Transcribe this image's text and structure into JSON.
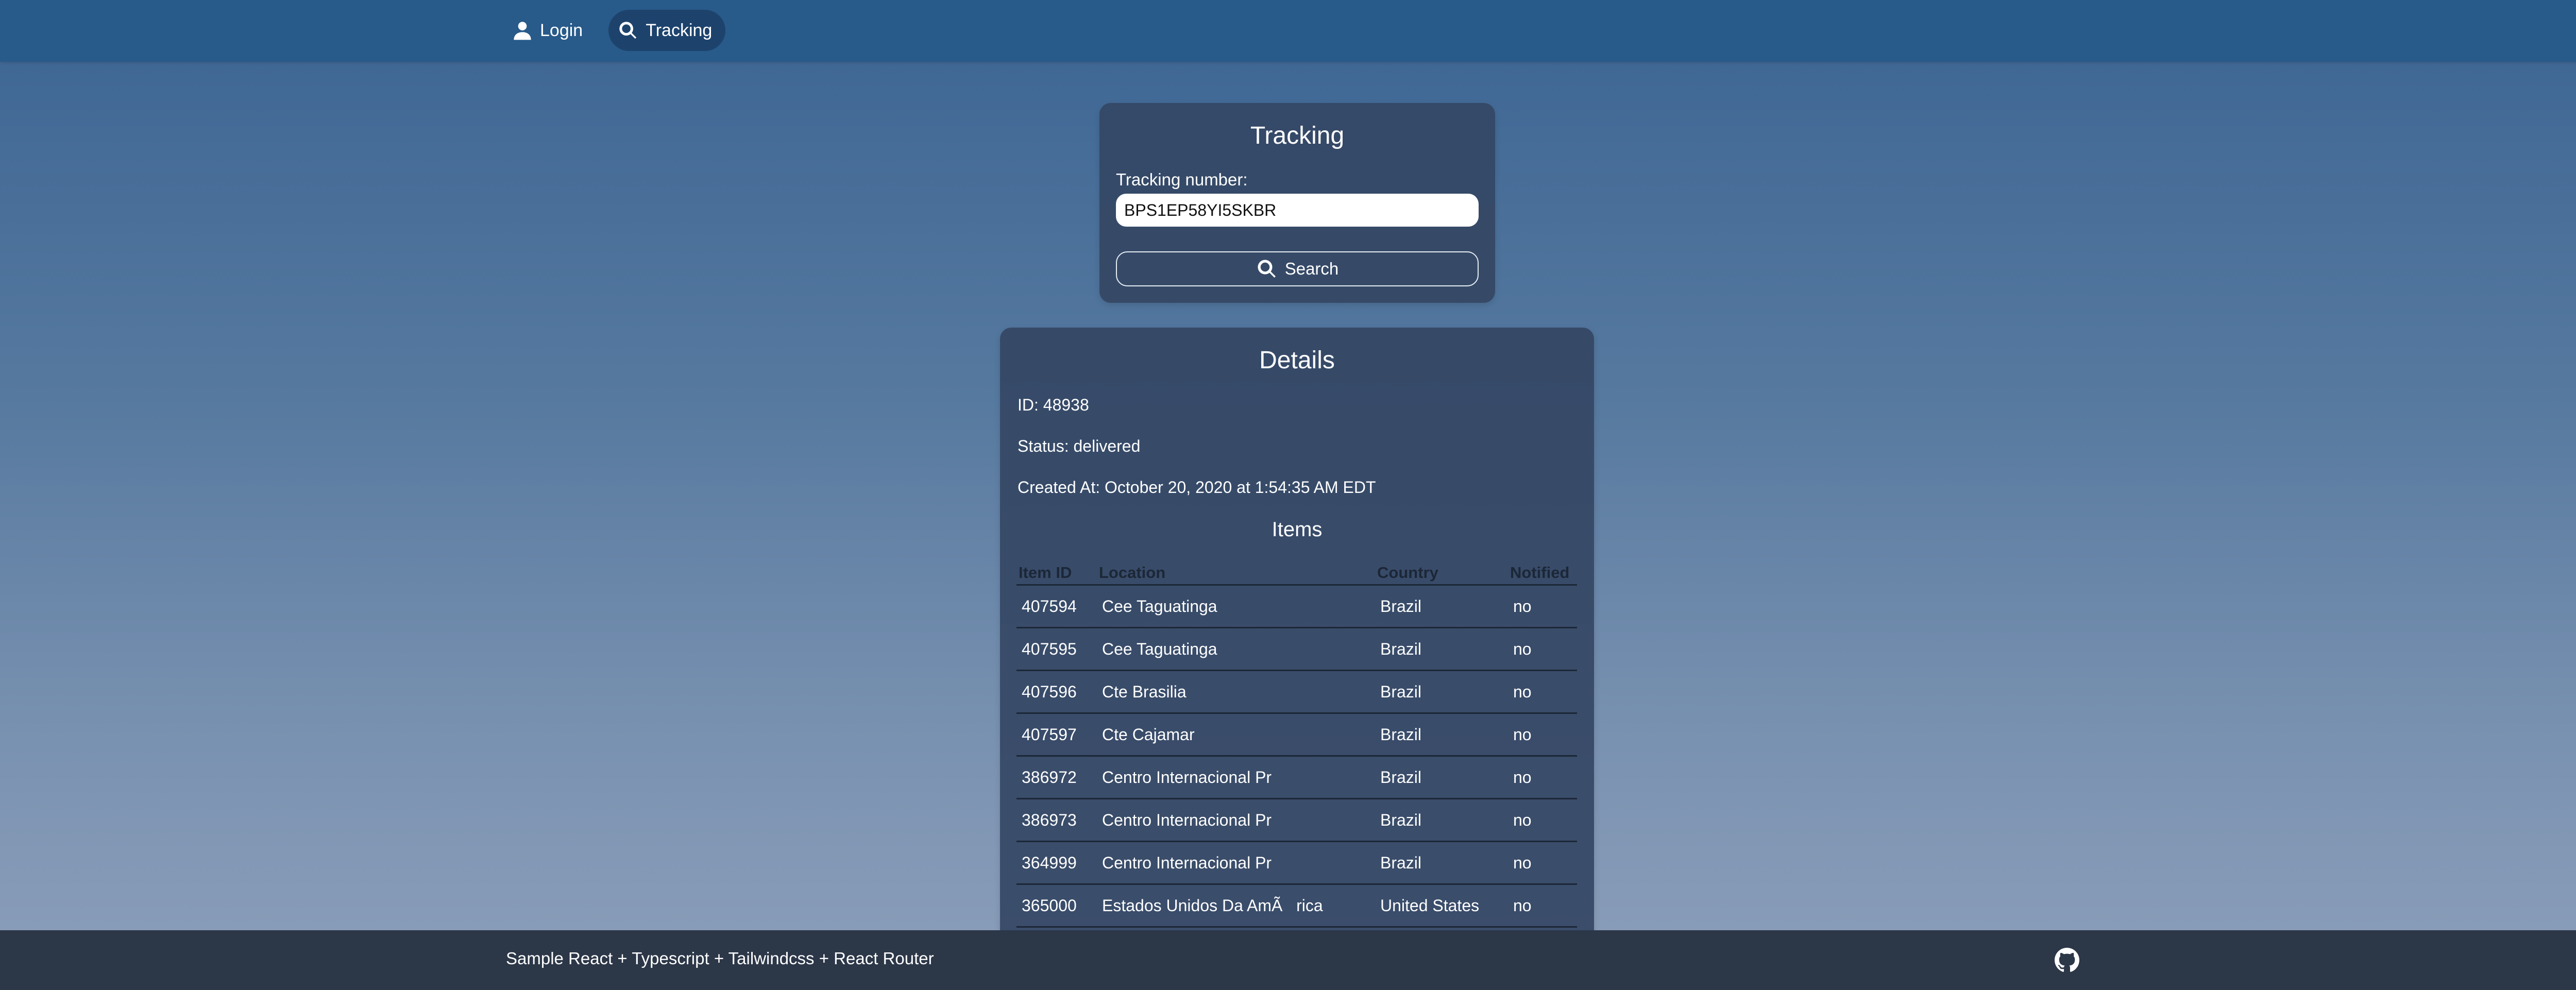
{
  "nav": {
    "login_label": "Login",
    "login_icon": "user-icon",
    "tracking_label": "Tracking",
    "tracking_icon": "search-icon"
  },
  "tracking_form": {
    "title": "Tracking",
    "field_label": "Tracking number:",
    "field_value": "BPS1EP58YI5SKBR",
    "search_label": "Search",
    "search_icon": "search-icon"
  },
  "details": {
    "title": "Details",
    "id_line": "ID: 48938",
    "status_line": "Status: delivered",
    "created_line": "Created At: October 20, 2020 at 1:54:35 AM EDT",
    "items_title": "Items",
    "columns": [
      "Item ID",
      "Location",
      "Country",
      "Notified"
    ],
    "rows": [
      [
        "407594",
        "Cee Taguatinga",
        "Brazil",
        "no"
      ],
      [
        "407595",
        "Cee Taguatinga",
        "Brazil",
        "no"
      ],
      [
        "407596",
        "Cte Brasilia",
        "Brazil",
        "no"
      ],
      [
        "407597",
        "Cte Cajamar",
        "Brazil",
        "no"
      ],
      [
        "386972",
        "Centro Internacional Pr",
        "Brazil",
        "no"
      ],
      [
        "386973",
        "Centro Internacional Pr",
        "Brazil",
        "no"
      ],
      [
        "364999",
        "Centro Internacional Pr",
        "Brazil",
        "no"
      ],
      [
        "365000",
        "Estados Unidos Da AmÃ   rica",
        "United States",
        "no"
      ]
    ]
  },
  "footer": {
    "text": "Sample React + Typescript + Tailwindcss + React Router",
    "github_icon": "github-icon"
  },
  "colors": {
    "header_bg": "#285a8a",
    "footer_bg": "#2c3748",
    "card_bg": "#344664"
  }
}
